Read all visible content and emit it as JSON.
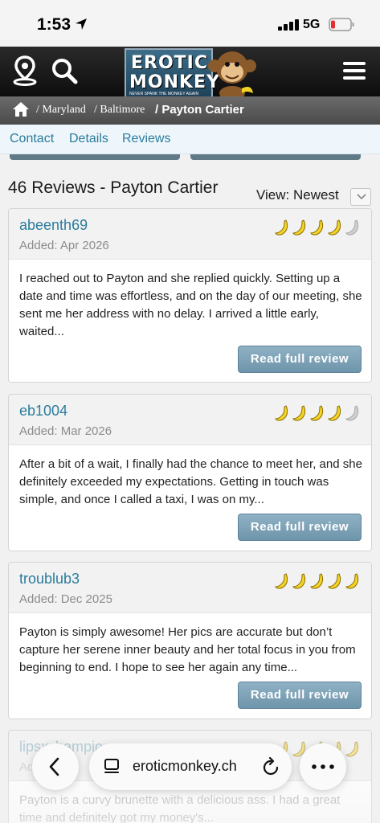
{
  "status_bar": {
    "time": "1:53",
    "network": "5G"
  },
  "header": {
    "logo_line1": "EROTIC",
    "logo_line2": "MONKEY",
    "logo_tagline": "NEVER SPANK THE MONKEY AGAIN"
  },
  "breadcrumb": {
    "items": [
      "/ Maryland",
      "/ Baltimore",
      "/ Payton Cartier"
    ]
  },
  "tabs": [
    "Contact",
    "Details",
    "Reviews"
  ],
  "reviews_header": {
    "title": "46 Reviews - Payton Cartier",
    "view_label": "View: Newest"
  },
  "reviews": [
    {
      "reviewer": "abeenth69",
      "added": "Added: Apr 2026",
      "rating": 4,
      "excerpt": "I reached out to Payton and she replied quickly. Setting up a date and time was effortless, and on the day of our meeting, she sent me her address with no delay. I arrived a little early, waited...",
      "button": "Read full review"
    },
    {
      "reviewer": "eb1004",
      "added": "Added: Mar 2026",
      "rating": 4,
      "excerpt": "After a bit of a wait, I finally had the chance to meet her, and she definitely exceeded my expectations. Getting in touch was simple, and once I called a taxi, I was on my...",
      "button": "Read full review"
    },
    {
      "reviewer": "troublub3",
      "added": "Added: Dec 2025",
      "rating": 5,
      "excerpt": "Payton is simply awesome! Her pics are accurate but don’t capture her serene inner beauty and her total focus in you from beginning to end. I hope to see her again any time...",
      "button": "Read full review"
    },
    {
      "reviewer": "lipsxchampio",
      "added": "Added",
      "rating": 5,
      "excerpt": "Payton is a curvy brunette with a delicious ass. I had a great time and definitely got my money's..."
    }
  ],
  "browser": {
    "url": "eroticmonkey.ch"
  },
  "colors": {
    "accent": "#2a7c9c",
    "button": "#7ea3b8",
    "banana": "#f3d327",
    "banana_inactive": "#cfcfcf"
  }
}
